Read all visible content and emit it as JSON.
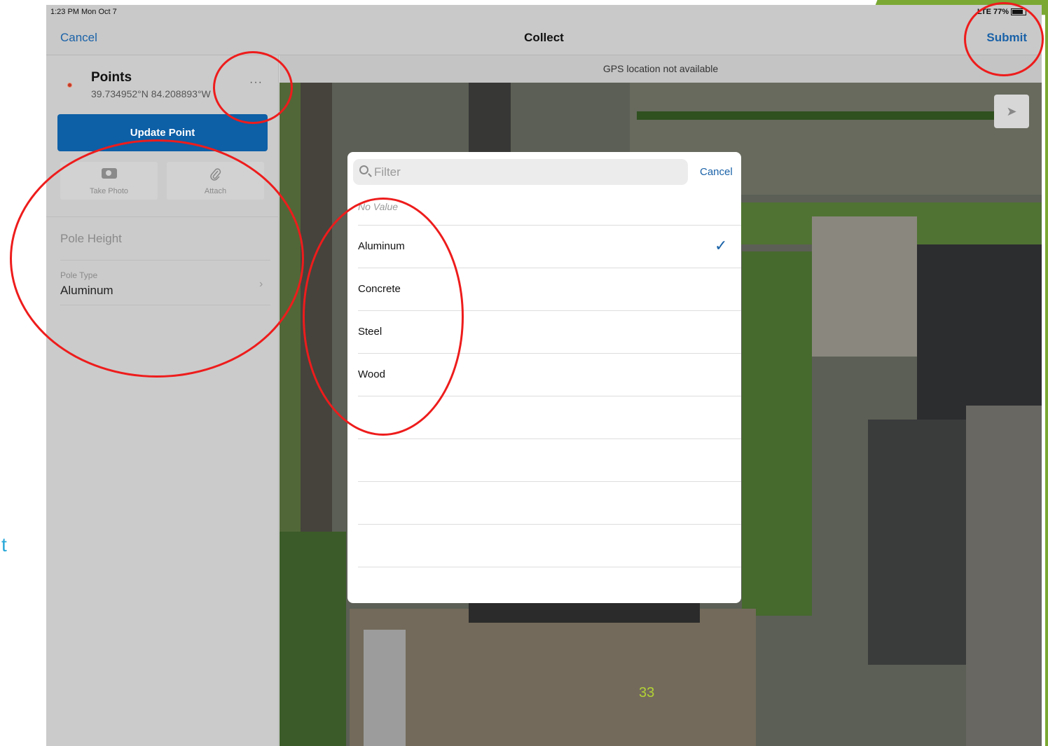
{
  "status_bar": {
    "time": "1:23 PM  Mon Oct 7",
    "indicators": "LTE  77%"
  },
  "nav": {
    "cancel": "Cancel",
    "title": "Collect",
    "submit": "Submit"
  },
  "feature": {
    "title": "Points",
    "coords": "39.734952°N  84.208893°W",
    "more": "···"
  },
  "update_button": "Update Point",
  "actions": [
    {
      "label": "Take Photo",
      "icon": "camera-icon"
    },
    {
      "label": "Attach",
      "icon": "paperclip-icon"
    }
  ],
  "fields": {
    "pole_height_label": "Pole Height",
    "pole_type_label": "Pole Type",
    "pole_type_value": "Aluminum"
  },
  "map": {
    "gps_banner": "GPS location not available"
  },
  "picker": {
    "filter_placeholder": "Filter",
    "cancel": "Cancel",
    "no_value": "No Value",
    "options": [
      "Aluminum",
      "Concrete",
      "Steel",
      "Wood"
    ],
    "selected": "Aluminum"
  },
  "slide": {
    "page_number": "33",
    "edge_text": "t"
  },
  "colors": {
    "accent_blue": "#1a62a8",
    "button_blue": "#0d5fa6",
    "annotation_red": "#ee1c1c",
    "slide_green": "#7aa833"
  }
}
